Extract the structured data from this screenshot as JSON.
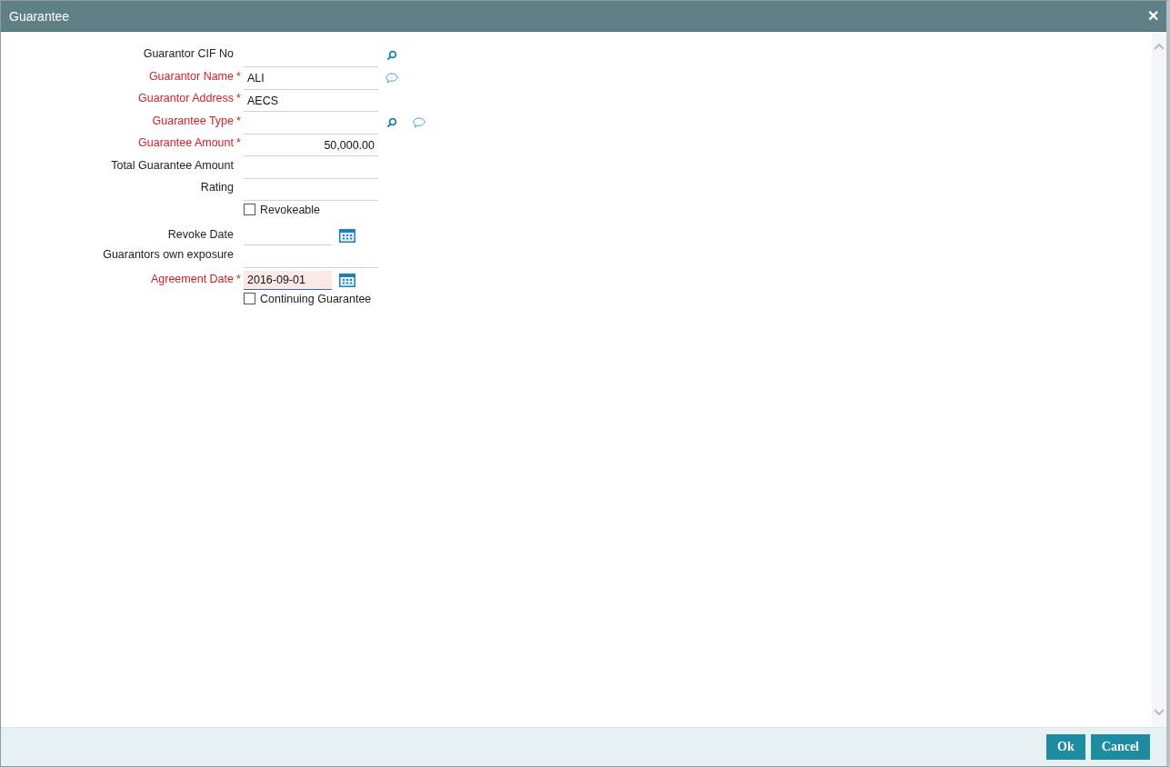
{
  "window": {
    "title": "Guarantee",
    "close": "✕"
  },
  "fields": [
    {
      "kind": "text",
      "label": "Guarantor CIF No",
      "required": false,
      "lookup": true,
      "comment": false
    },
    {
      "kind": "text",
      "label": "Guarantor Name",
      "required": true,
      "mark": "*",
      "value": "ALI",
      "numeric": false,
      "lookup": false,
      "comment": true
    },
    {
      "kind": "text",
      "label": "Guarantor Address",
      "required": true,
      "mark": "*",
      "value": "AECS",
      "numeric": false,
      "lookup": false,
      "comment": false
    },
    {
      "kind": "text",
      "label": "Guarantee Type",
      "required": true,
      "mark": "*",
      "lookup": true,
      "comment": true
    },
    {
      "kind": "text",
      "label": "Guarantee Amount",
      "required": true,
      "mark": "*",
      "value": "50,000.00",
      "numeric": true,
      "lookup": false,
      "comment": false
    },
    {
      "kind": "text",
      "label": "Total Guarantee Amount",
      "required": false,
      "lookup": false,
      "comment": false
    },
    {
      "kind": "text",
      "label": "Rating",
      "required": false,
      "lookup": false,
      "comment": false
    },
    {
      "kind": "checkbox",
      "label": "Revokeable",
      "checked": false
    },
    {
      "kind": "date",
      "label": "Revoke Date",
      "required": false,
      "focused": false
    },
    {
      "kind": "text",
      "label": "Guarantors own exposure",
      "required": false,
      "lookup": false,
      "comment": false
    },
    {
      "kind": "date",
      "label": "Agreement Date",
      "required": true,
      "mark": "*",
      "value": "2016-09-01",
      "focused": true
    },
    {
      "kind": "checkbox",
      "label": "Continuing Guarantee",
      "checked": false
    }
  ],
  "buttons": [
    "Ok",
    "Cancel"
  ]
}
